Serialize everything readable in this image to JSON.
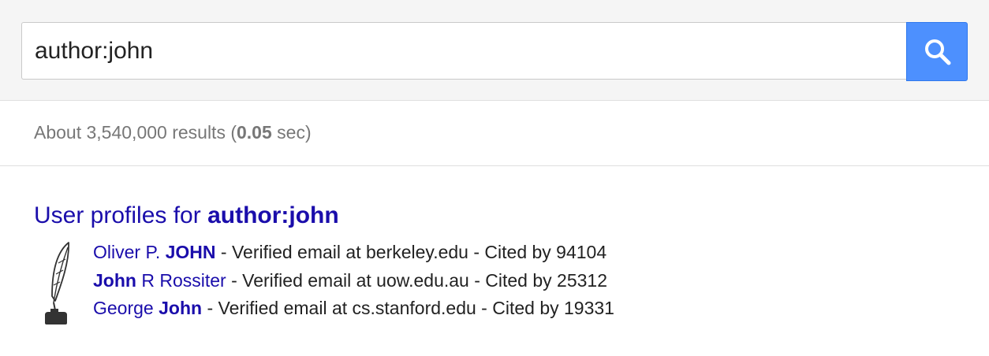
{
  "search": {
    "query": "author:john"
  },
  "stats": {
    "prefix": "About 3,540,000 results (",
    "time": "0.05",
    "suffix": " sec)"
  },
  "profiles": {
    "title_prefix": "User profiles for ",
    "title_query": "author:john",
    "items": [
      {
        "name_parts": [
          {
            "text": "Oliver P. ",
            "bold": false
          },
          {
            "text": "JOHN",
            "bold": true
          }
        ],
        "details": " - Verified email at berkeley.edu - Cited by 94104"
      },
      {
        "name_parts": [
          {
            "text": "John",
            "bold": true
          },
          {
            "text": " R Rossiter",
            "bold": false
          }
        ],
        "details": " - Verified email at uow.edu.au - Cited by 25312"
      },
      {
        "name_parts": [
          {
            "text": "George ",
            "bold": false
          },
          {
            "text": "John",
            "bold": true
          }
        ],
        "details": " - Verified email at cs.stanford.edu - Cited by 19331"
      }
    ]
  },
  "icons": {
    "search_button": "search-icon",
    "profiles": "quill-pen-icon"
  },
  "colors": {
    "link": "#1a0dab",
    "search_button": "#4d90fe",
    "header_background": "#f5f5f5",
    "stats_text": "#777777"
  }
}
